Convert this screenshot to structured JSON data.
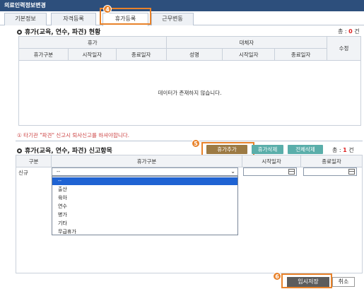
{
  "window": {
    "title": "의료인력정보변경"
  },
  "tabs": [
    {
      "label": "기본정보",
      "active": false
    },
    {
      "label": "자격등록",
      "active": false
    },
    {
      "label": "휴가등록",
      "active": true
    },
    {
      "label": "근무변동",
      "active": false
    }
  ],
  "markers": {
    "tab": "4",
    "add": "5",
    "save": "6"
  },
  "status_section": {
    "title": "휴가(교육, 연수, 파견) 현황",
    "count_prefix": "총 : ",
    "count": "0",
    "count_suffix": " 건",
    "group_vacation": "휴가",
    "group_substitute": "대체자",
    "col_edit": "수정",
    "columns": [
      "휴가구분",
      "시작일자",
      "종료일자",
      "성명",
      "시작일자",
      "종료일자"
    ],
    "empty_message": "데이터가 존재하지 않습니다."
  },
  "notice": "① 타기관 \"파견\" 신고시 퇴사신고를 하셔야합니다.",
  "request_section": {
    "title": "휴가(교육, 연수, 파견) 신고항목",
    "add_button": "휴가추가",
    "delete_button": "휴가삭제",
    "delete_all_button": "전체삭제",
    "count_prefix": "총 : ",
    "count": "1",
    "count_suffix": " 건",
    "columns": [
      "구분",
      "휴가구분",
      "시작일자",
      "종료일자"
    ],
    "row_label": "신규",
    "select_value": "--",
    "options": [
      "--",
      "출산",
      "육아",
      "연수",
      "병가",
      "기타",
      "무급휴가"
    ]
  },
  "actions": {
    "save": "임시저장",
    "cancel": "취소"
  },
  "colors": {
    "accent_orange": "#e8822a",
    "titlebar": "#2d4f7c",
    "add_button": "#9c7a44",
    "teal_button": "#5aaeaa",
    "selected_option": "#1f63d3"
  }
}
